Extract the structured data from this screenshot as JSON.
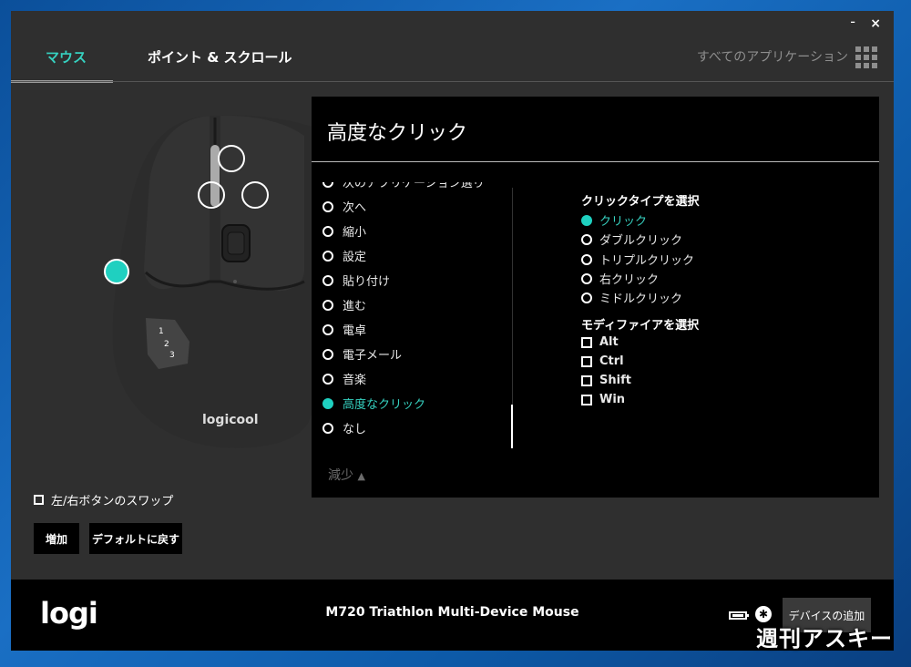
{
  "window": {
    "minimize": "-",
    "close": "×"
  },
  "tabs": [
    {
      "label": "マウス"
    },
    {
      "label": "ポイント & スクロール"
    }
  ],
  "all_apps": "すべてのアプリケーション",
  "mouse": {
    "brand": "logicool",
    "side_buttons": [
      "1",
      "2",
      "3"
    ]
  },
  "swap_label": "左/右ボタンのスワップ",
  "buttons": {
    "add": "増加",
    "default": "デフォルトに戻す"
  },
  "panel": {
    "title": "高度なクリック",
    "list": [
      "次のアプリケーション選り",
      "次へ",
      "縮小",
      "設定",
      "貼り付け",
      "進む",
      "電卓",
      "電子メール",
      "音楽",
      "高度なクリック",
      "なし"
    ],
    "selected_index": 9,
    "collapse_label": "減少",
    "click_type_title": "クリックタイプを選択",
    "click_types": [
      "クリック",
      "ダブルクリック",
      "トリプルクリック",
      "右クリック",
      "ミドルクリック"
    ],
    "modifier_title": "モディファイアを選択",
    "modifiers": [
      "Alt",
      "Ctrl",
      "Shift",
      "Win"
    ]
  },
  "footer": {
    "logo": "logi",
    "device": "M720 Triathlon Multi-Device Mouse",
    "add_device": "デバイスの追加"
  },
  "watermark": "週刊アスキー",
  "colors": {
    "accent": "#36d1c0",
    "panel": "#000000",
    "app_bg": "#2f2f2f"
  }
}
